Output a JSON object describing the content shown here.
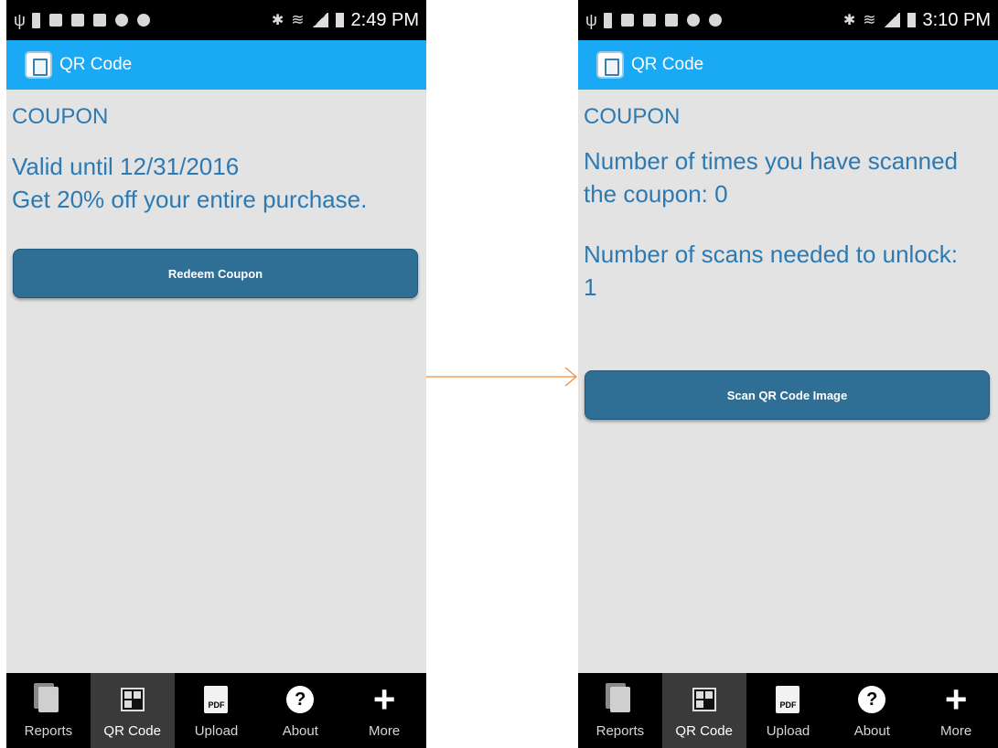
{
  "left": {
    "status": {
      "time": "2:49 PM"
    },
    "appbar": {
      "title": "QR Code"
    },
    "content": {
      "heading": "COUPON",
      "line1": "Valid until 12/31/2016",
      "line2": "Get 20% off your entire purchase.",
      "button": "Redeem Coupon"
    },
    "tabs": [
      "Reports",
      "QR Code",
      "Upload",
      "About",
      "More"
    ],
    "active_tab": "QR Code"
  },
  "right": {
    "status": {
      "time": "3:10 PM"
    },
    "appbar": {
      "title": "QR Code"
    },
    "content": {
      "heading": "COUPON",
      "scanned_line1": "Number of times you have scanned",
      "scanned_line2": "the coupon: 0",
      "needed_line1": "Number of scans needed to unlock:",
      "needed_line2": "1",
      "button": "Scan QR Code Image"
    },
    "tabs": [
      "Reports",
      "QR Code",
      "Upload",
      "About",
      "More"
    ],
    "active_tab": "QR Code"
  },
  "icons": {
    "pdf_label": "PDF",
    "about_glyph": "?",
    "more_glyph": "+"
  },
  "colors": {
    "app_bar": "#1aa9f4",
    "text_blue": "#2d7ab2",
    "button": "#2f6f96",
    "arrow": "#f08a3c"
  }
}
